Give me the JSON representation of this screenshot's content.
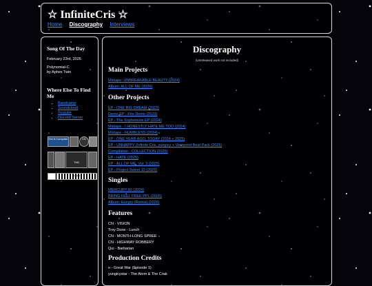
{
  "header": {
    "title": "☆ InfiniteCris ☆",
    "nav": [
      "Home",
      "Discography",
      "Interviews"
    ]
  },
  "sidebar": {
    "song_heading": "Song Of The Day",
    "song_date": "February 23rd, 2026",
    "song_title": "Polynomial-C",
    "song_artist": "by Aphex Twin",
    "find_heading": "Where Else To Find Me",
    "links": [
      "Bandcamp",
      "Soundcloud",
      "Youtube",
      "Discord Server"
    ],
    "badges": [
      "Get A Computer",
      "CD",
      "",
      "THE",
      "",
      "Linux"
    ]
  },
  "main": {
    "heading": "Discography",
    "note": "(Unreleased work not included)",
    "main_projects_heading": "Main Projects",
    "main_projects": [
      "Mixtape: UNBREAKABLE BEAUTY (2024)",
      "Album: ALL OF ME (2026)"
    ],
    "other_projects_heading": "Other Projects",
    "other_projects": [
      "EP - ONE BIG DREAM (2023)",
      "Demo EP - Fire Demo (2023)",
      "EP - The Sophomore EP (2024)",
      "Mixtape - I HONESTLY HATE ME TOO (2024)",
      "Mixtape - NUMBLESS (2024)",
      "EP - ONE YEAR AGO, TODAY (2024 + 2025)",
      "EP - UNHAPPY (Infinite Cris, yungicy + Viewpoint Beat Pack (2025)",
      "Compilation - COLLECTION (2025)",
      "EP - HATE (2025)",
      "EP - ALL OF ME, Vol. 3 (2025)",
      "EP - Project Sweet 10 (2025)"
    ],
    "singles_heading": "Singles",
    "singles": [
      "MERCURY.90 (2024)",
      "BRING FEEL FREE PPL (2026)",
      "Album: Hungry (Remix) (2026)"
    ],
    "features_heading": "Features",
    "features": [
      "CN - VISION",
      "Trey Done - Lunch",
      "CN - MONTH-LONG SPREE",
      "CN - HIGHWAY ROBBERY",
      "Qui - Barbarian"
    ],
    "production_heading": "Production Credits",
    "production": [
      "ʜ - Great War (Episode 1)",
      "yungicystar - The Atom & The Crab"
    ]
  }
}
